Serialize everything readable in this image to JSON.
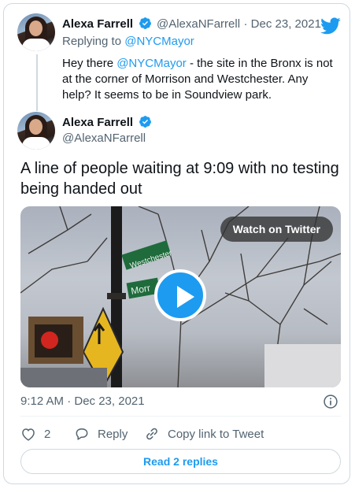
{
  "reply_tweet": {
    "name": "Alexa Farrell",
    "handle": "@AlexaNFarrell",
    "date": "· Dec 23, 2021",
    "replying_prefix": "Replying to ",
    "replying_to": "@NYCMayor",
    "text_before": "Hey there ",
    "text_mention": "@NYCMayor",
    "text_after": " - the site in the Bronx is not at the corner of Morrison and Westchester. Any help? It seems to be in Soundview park."
  },
  "main_tweet": {
    "name": "Alexa Farrell",
    "handle": "@AlexaNFarrell",
    "text": "A line of people waiting at 9:09 with no testing being handed out",
    "media": {
      "watch_label": "Watch on Twitter",
      "sign_1": "Westchester",
      "sign_2": "Morr"
    },
    "time": "9:12 AM · Dec 23, 2021"
  },
  "actions": {
    "like_count": "2",
    "reply_label": "Reply",
    "copy_label": "Copy link to Tweet"
  },
  "read_replies_label": "Read 2 replies",
  "icons": {
    "brand": "twitter-bird-icon",
    "verified": "verified-badge-icon",
    "play": "play-icon",
    "info": "info-icon",
    "like": "heart-icon",
    "reply": "reply-bubble-icon",
    "copy": "link-icon"
  },
  "colors": {
    "accent": "#1d9bf0",
    "text": "#0f1419",
    "muted": "#536471",
    "border": "#cfd9de"
  }
}
